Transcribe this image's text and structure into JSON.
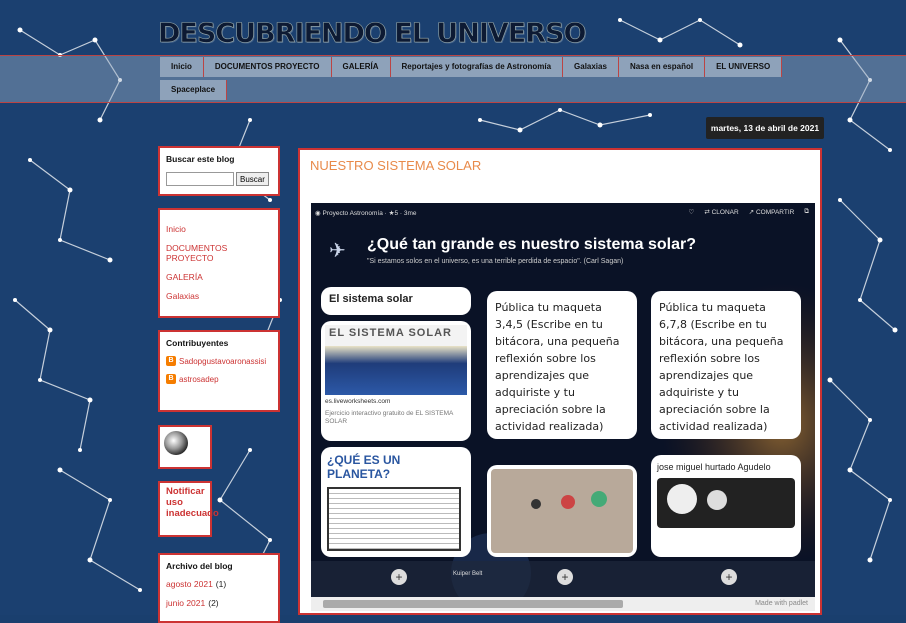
{
  "site": {
    "title": "DESCUBRIENDO EL UNIVERSO"
  },
  "nav": {
    "row1": [
      "Inicio",
      "DOCUMENTOS PROYECTO",
      "GALERÍA",
      "Reportajes y fotografías de Astronomía",
      "Galaxias",
      "Nasa en español",
      "EL UNIVERSO"
    ],
    "row2": [
      "Spaceplace"
    ]
  },
  "date": "martes, 13 de abril de 2021",
  "search": {
    "heading": "Buscar este blog",
    "button": "Buscar",
    "value": ""
  },
  "pages": {
    "items": [
      "Inicio",
      "DOCUMENTOS PROYECTO",
      "GALERÍA",
      "Galaxias"
    ]
  },
  "contributors": {
    "heading": "Contribuyentes",
    "items": [
      "Sadopgustavoaronassisi",
      "astrosadep"
    ]
  },
  "report": "Notificar uso inadecuado",
  "archive": {
    "heading": "Archivo del blog",
    "items": [
      {
        "label": "agosto 2021",
        "count": "(1)"
      },
      {
        "label": "junio 2021",
        "count": "(2)"
      }
    ]
  },
  "post": {
    "title": "NUESTRO SISTEMA SOLAR"
  },
  "padlet": {
    "author": "Proyecto Astronomía",
    "likes": "5",
    "age": "3me",
    "clone": "CLONAR",
    "share": "COMPARTIR",
    "title": "¿Qué tan grande es nuestro sistema solar?",
    "subtitle": "\"Si estamos solos en el universo, es una terrible perdida de espacio\". (Carl Sagan)",
    "col1_title": "El sistema solar",
    "col1_img_text": "EL SISTEMA SOLAR",
    "col1_domain": "es.liveworksheets.com",
    "col1_desc": "Ejercicio interactivo gratuito de EL SISTEMA SOLAR",
    "col1_card2": "¿QUÉ ES UN PLANETA?",
    "col2_text": "Pública tu maqueta 3,4,5 (Escribe en tu bitácora, una pequeña reflexión sobre los aprendizajes que adquiriste y tu apreciación sobre la actividad realizada)",
    "col3_text": "Pública tu maqueta 6,7,8 (Escribe en tu bitácora, una pequeña reflexión sobre los aprendizajes que adquiriste y tu apreciación sobre la actividad realizada)",
    "col3_author": "jose miguel hurtado Agudelo",
    "footer_label": "Kuiper Belt",
    "made_with": "Made with padlet"
  },
  "colors": {
    "accent": "#cc3333",
    "background": "#1a3f6e",
    "post_title": "#e88a4a"
  }
}
